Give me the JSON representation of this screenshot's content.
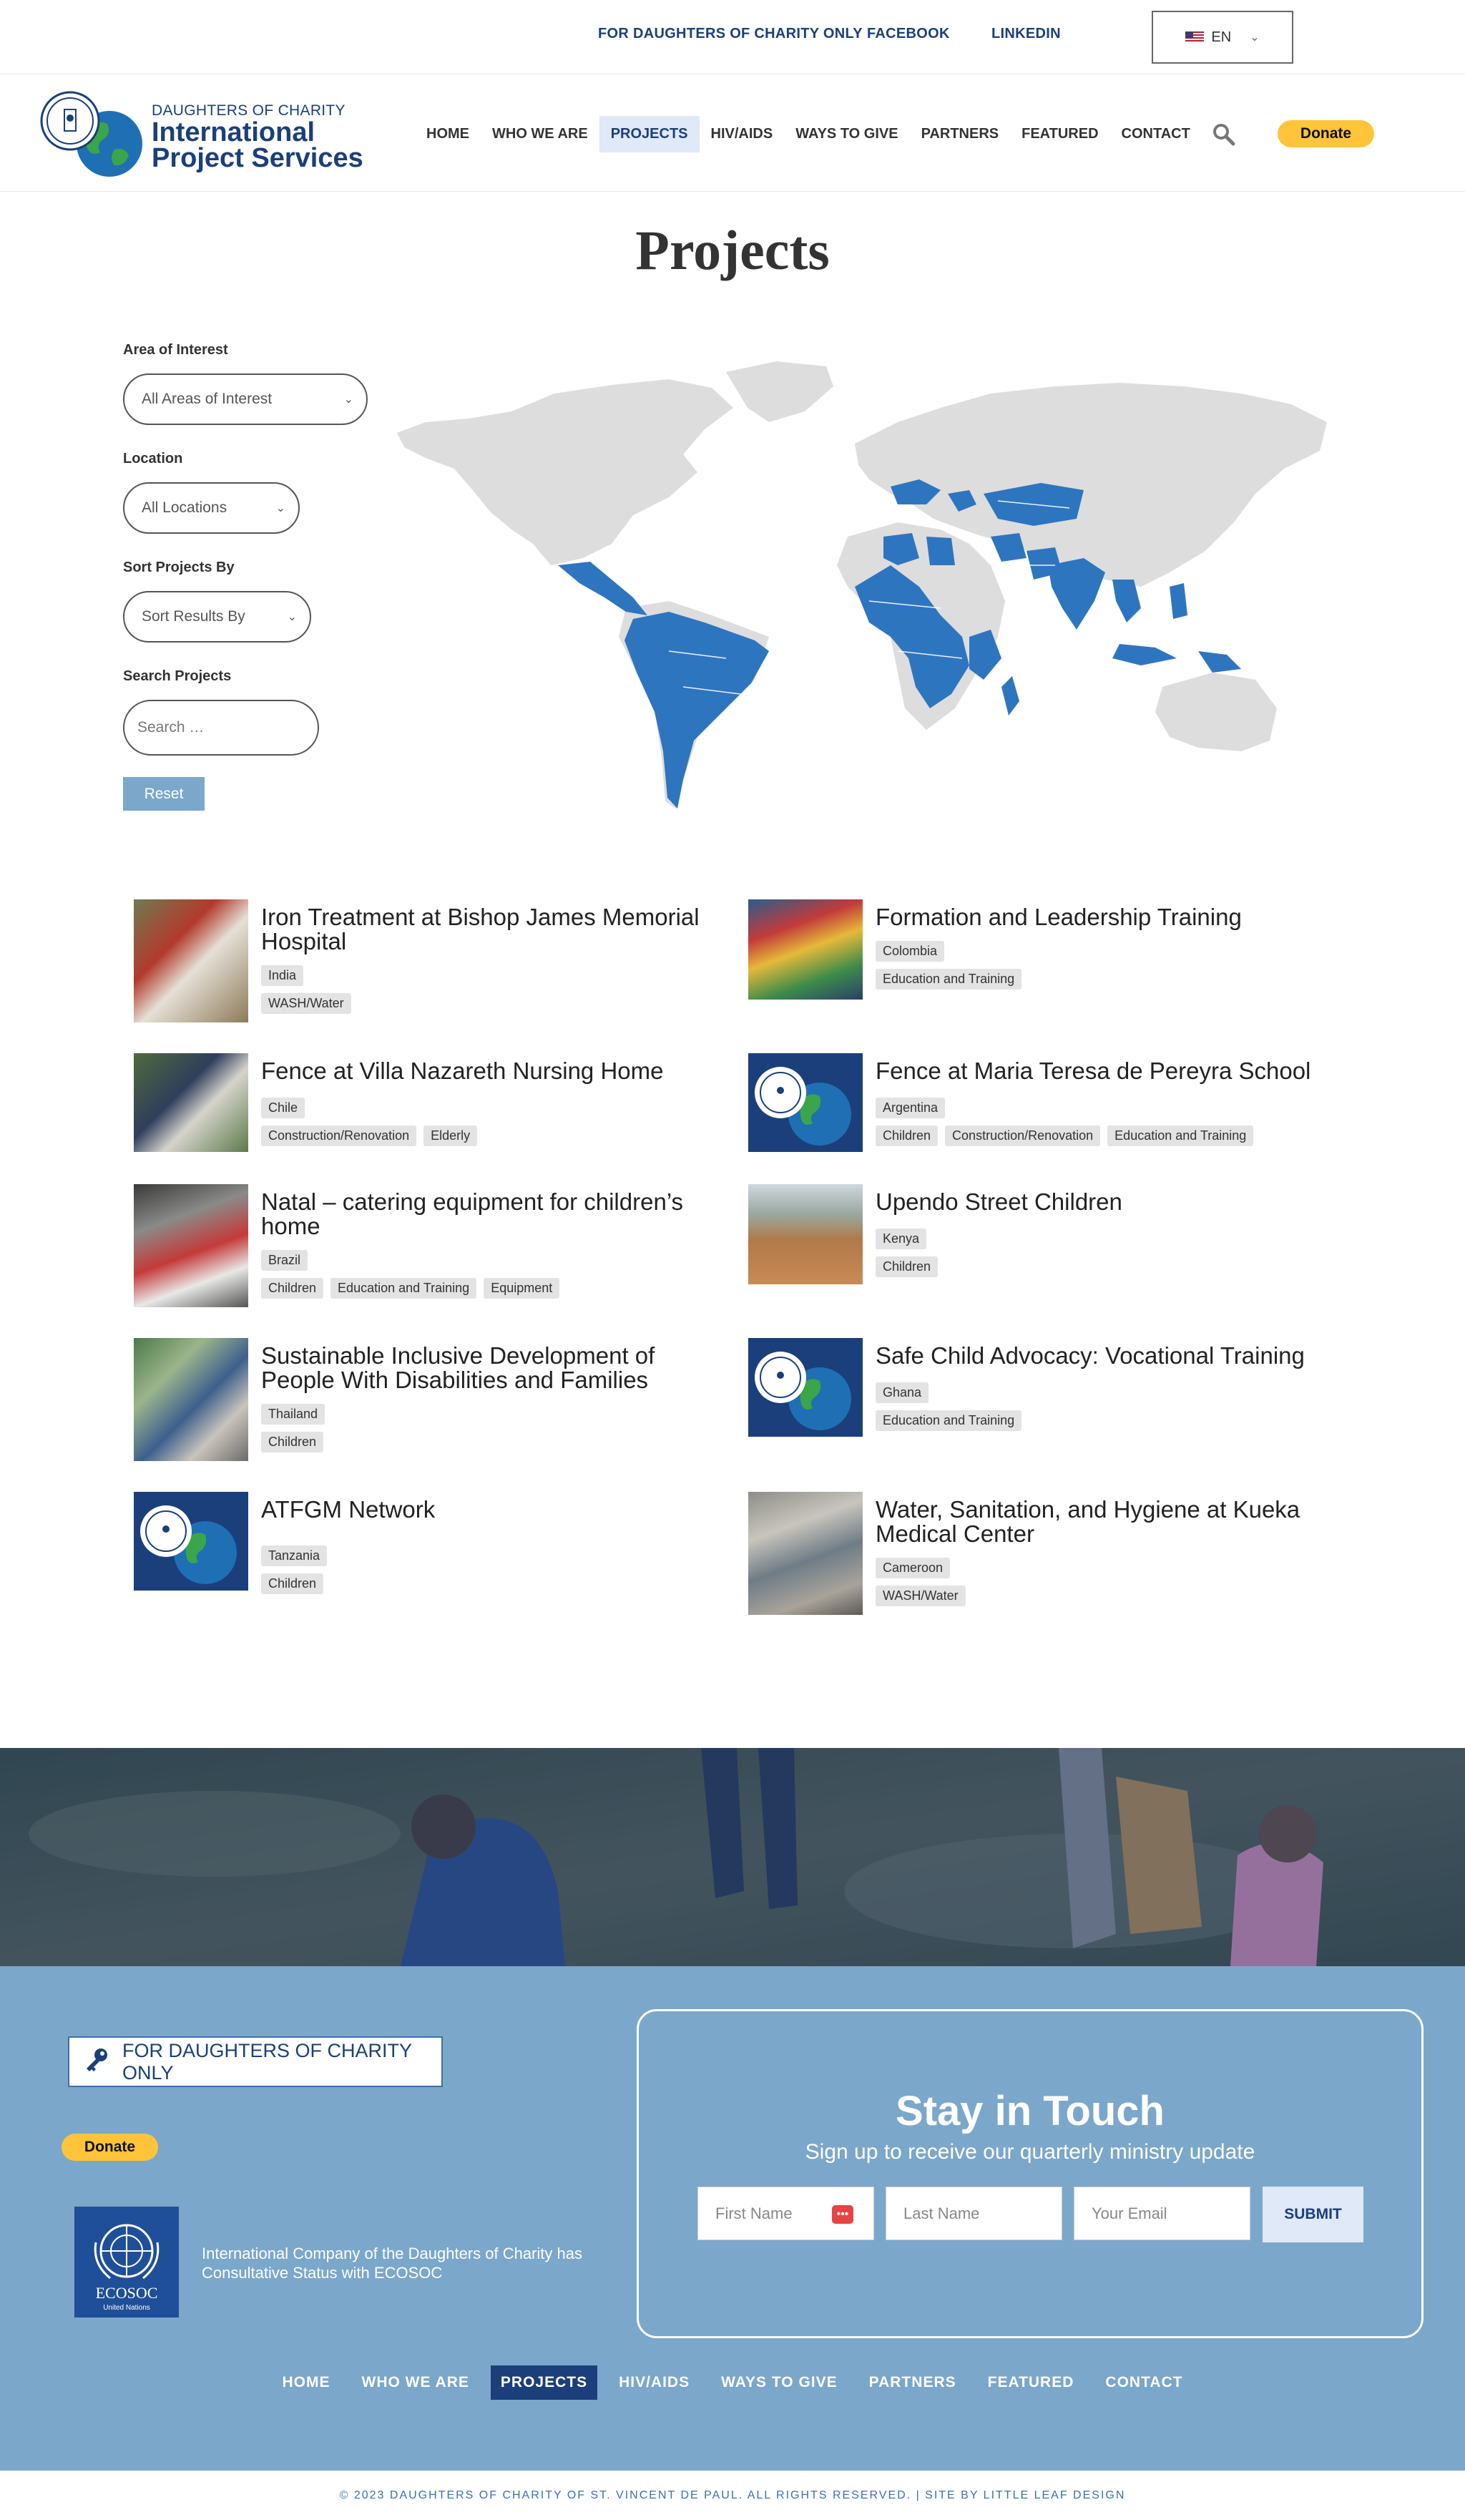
{
  "topbar": {
    "links": [
      "FOR DAUGHTERS OF CHARITY ONLY",
      "FACEBOOK",
      "LINKEDIN"
    ],
    "language": "EN"
  },
  "header": {
    "logo_small": "DAUGHTERS OF CHARITY",
    "logo_line1": "International",
    "logo_line2": "Project Services",
    "nav": [
      "HOME",
      "WHO WE ARE",
      "PROJECTS",
      "HIV/AIDS",
      "WAYS TO GIVE",
      "PARTNERS",
      "FEATURED",
      "CONTACT"
    ],
    "active_nav": "PROJECTS",
    "donate_label": "Donate"
  },
  "page_title": "Projects",
  "filters": {
    "area_label": "Area of Interest",
    "area_value": "All Areas of Interest",
    "location_label": "Location",
    "location_value": "All Locations",
    "sort_label": "Sort Projects By",
    "sort_value": "Sort Results By",
    "search_label": "Search Projects",
    "search_placeholder": "Search …",
    "reset_label": "Reset"
  },
  "colors": {
    "brand_blue": "#1b3f7a",
    "map_highlight": "#2e75c0",
    "map_land": "#dddddd",
    "footer_bg": "#7ba7cb",
    "donate_yellow": "#ffc439"
  },
  "projects": [
    {
      "title": "Iron Treatment at Bishop James Memorial Hospital",
      "location": "India",
      "tags": [
        "WASH/Water"
      ]
    },
    {
      "title": "Formation and Leadership Training",
      "location": "Colombia",
      "tags": [
        "Education and Training"
      ]
    },
    {
      "title": "Fence at Villa Nazareth Nursing Home",
      "location": "Chile",
      "tags": [
        "Construction/Renovation",
        "Elderly"
      ]
    },
    {
      "title": "Fence at Maria Teresa de Pereyra School",
      "location": "Argentina",
      "tags": [
        "Children",
        "Construction/Renovation",
        "Education and Training"
      ]
    },
    {
      "title": "Natal – catering equipment for children’s home",
      "location": "Brazil",
      "tags": [
        "Children",
        "Education and Training",
        "Equipment"
      ]
    },
    {
      "title": "Upendo Street Children",
      "location": "Kenya",
      "tags": [
        "Children"
      ]
    },
    {
      "title": "Sustainable Inclusive Development of People With Disabilities and Families",
      "location": "Thailand",
      "tags": [
        "Children"
      ]
    },
    {
      "title": "Safe Child Advocacy: Vocational Training",
      "location": "Ghana",
      "tags": [
        "Education and Training"
      ]
    },
    {
      "title": "ATFGM Network",
      "location": "Tanzania",
      "tags": [
        "Children"
      ]
    },
    {
      "title": "Water, Sanitation, and Hygiene at Kueka Medical Center",
      "location": "Cameroon",
      "tags": [
        "WASH/Water"
      ]
    }
  ],
  "footer": {
    "members_label": "FOR DAUGHTERS OF CHARITY ONLY",
    "donate_label": "Donate",
    "ecosoc_text": "International Company of the Daughters of Charity has Consultative Status with ECOSOC",
    "ecosoc_logo_text": "ECOSOC",
    "ecosoc_logo_sub": "United Nations",
    "stay_title": "Stay in Touch",
    "stay_sub": "Sign up to receive our quarterly ministry update",
    "first_name_placeholder": "First Name",
    "last_name_placeholder": "Last Name",
    "email_placeholder": "Your Email",
    "submit_label": "SUBMIT",
    "nav": [
      "HOME",
      "WHO WE ARE",
      "PROJECTS",
      "HIV/AIDS",
      "WAYS TO GIVE",
      "PARTNERS",
      "FEATURED",
      "CONTACT"
    ],
    "copyright": "© 2023 DAUGHTERS OF CHARITY OF ST. VINCENT DE PAUL. ALL RIGHTS RESERVED. | SITE BY LITTLE LEAF DESIGN"
  }
}
